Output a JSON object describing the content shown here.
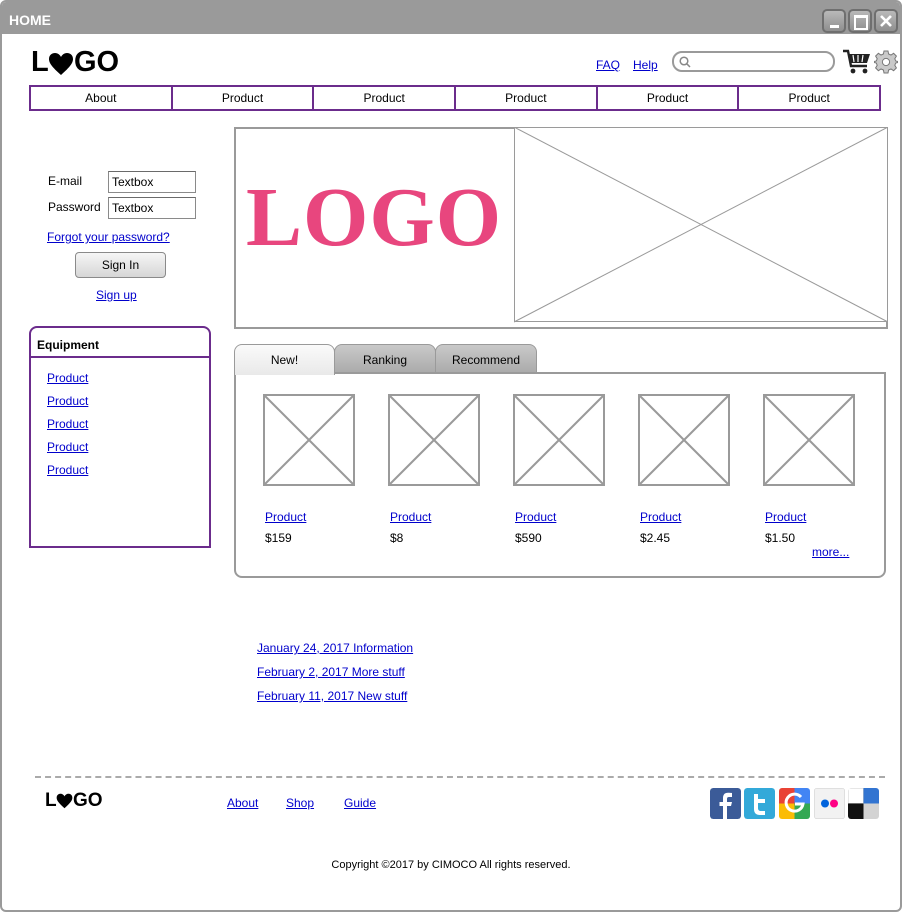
{
  "window": {
    "title": "HOME"
  },
  "header": {
    "logo": "LOGO",
    "links": [
      "FAQ",
      "Help"
    ],
    "search": {
      "value": "",
      "placeholder": ""
    }
  },
  "nav": [
    "About",
    "Product",
    "Product",
    "Product",
    "Product",
    "Product"
  ],
  "login": {
    "email_label": "E-mail",
    "email_value": "Textbox",
    "password_label": "Password",
    "password_value": "Textbox",
    "forgot": "Forgot your password?",
    "signin": "Sign In",
    "signup": "Sign up"
  },
  "equipment": {
    "title": "Equipment",
    "items": [
      "Product",
      "Product",
      "Product",
      "Product",
      "Product"
    ]
  },
  "hero": {
    "logo_text": "LOGO"
  },
  "tabs": [
    "New!",
    "Ranking",
    "Recommend"
  ],
  "products": [
    {
      "name": "Product",
      "price": "$159"
    },
    {
      "name": "Product",
      "price": "$8"
    },
    {
      "name": "Product",
      "price": "$590"
    },
    {
      "name": "Product",
      "price": "$2.45"
    },
    {
      "name": "Product",
      "price": "$1.50"
    }
  ],
  "more": "more...",
  "news": [
    "January 24, 2017  Information",
    "February 2, 2017  More stuff",
    "February 11, 2017  New stuff"
  ],
  "footer": {
    "logo": "LOGO",
    "links": [
      "About",
      "Shop",
      "Guide"
    ],
    "social": [
      "facebook-icon",
      "twitter-icon",
      "google-icon",
      "flickr-icon",
      "delicious-icon"
    ],
    "copyright": "Copyright ©2017 by CIMOCO All rights reserved."
  },
  "colors": {
    "accent": "#6b2c8c",
    "hero_logo": "#e8467e",
    "link": "#0000cc",
    "chrome": "#9a9a9a"
  }
}
